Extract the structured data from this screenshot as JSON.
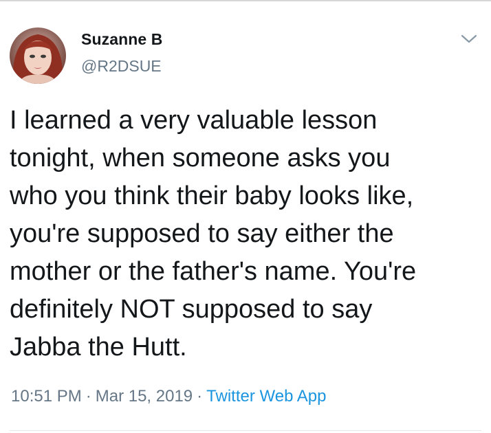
{
  "user": {
    "display_name": "Suzanne B",
    "handle": "@R2DSUE",
    "avatar_icon": "profile-photo"
  },
  "menu": {
    "icon": "chevron-down-icon"
  },
  "tweet": {
    "text": "I learned a very valuable lesson\ntonight, when someone asks you\nwho you think their baby looks like,\nyou're supposed to say either the\nmother or the father's name. You're\ndefinitely NOT supposed to say\nJabba the Hutt."
  },
  "meta": {
    "time": "10:51 PM",
    "separator": "·",
    "date": "Mar 15, 2019",
    "source": "Twitter Web App"
  },
  "colors": {
    "text": "#14171a",
    "secondary": "#657786",
    "link": "#1b95e0",
    "divider": "#e1e8ed"
  }
}
